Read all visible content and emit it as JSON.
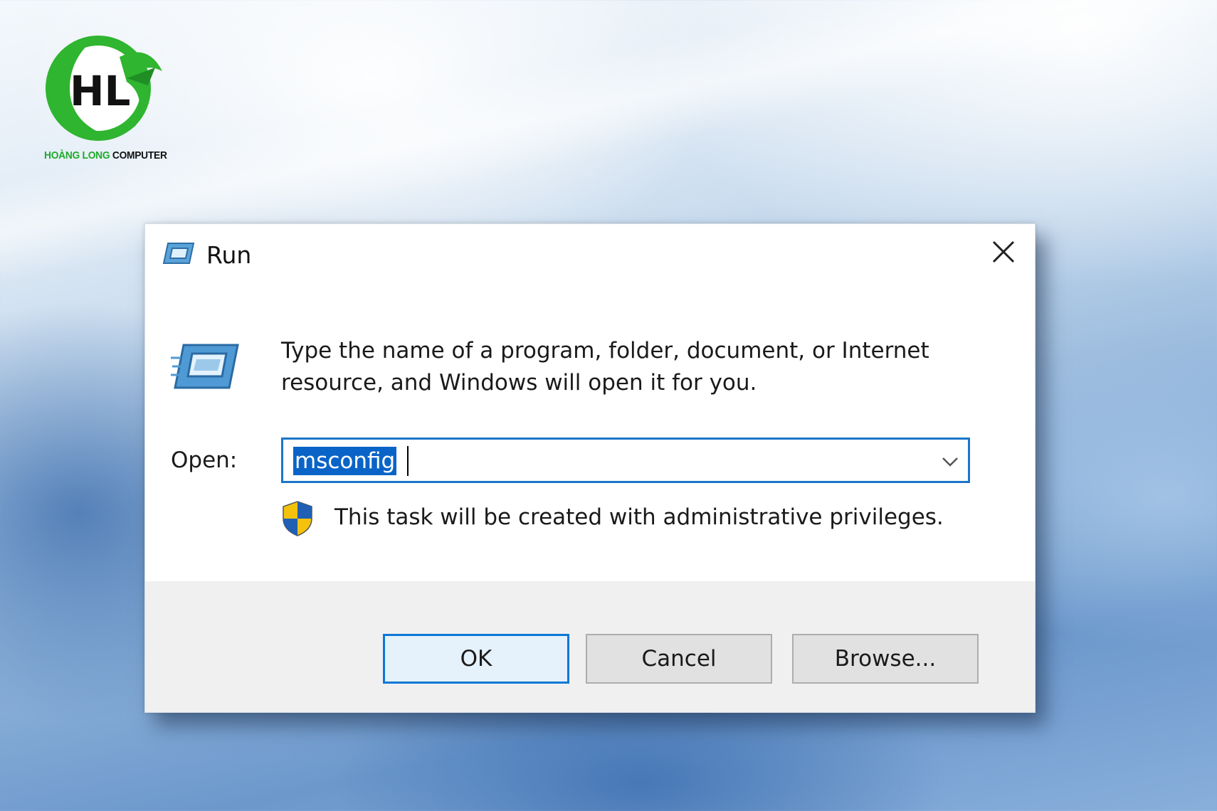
{
  "logo": {
    "brand_green": "HOÀNG LONG",
    "brand_dark": "COMPUTER",
    "monogram": "HL",
    "colors": {
      "green": "#1faa2c",
      "dark": "#111111"
    }
  },
  "dialog": {
    "title": "Run",
    "close_icon": "close-icon",
    "description": "Type the name of a program, folder, document, or Internet resource, and Windows will open it for you.",
    "open_label": "Open:",
    "open_value": "msconfig",
    "admin_note": "This task will be created with administrative privileges.",
    "buttons": {
      "ok": "OK",
      "cancel": "Cancel",
      "browse": "Browse..."
    },
    "colors": {
      "selection": "#0a64c8",
      "focus_border": "#1a76c8"
    }
  }
}
